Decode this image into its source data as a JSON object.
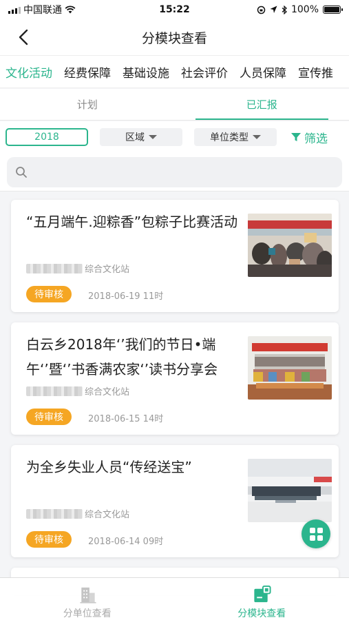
{
  "status_bar": {
    "carrier": "中国联通",
    "time": "15:22",
    "battery": "100%"
  },
  "nav": {
    "title": "分模块查看"
  },
  "module_tabs": [
    {
      "label": "文化活动",
      "active": true
    },
    {
      "label": "经费保障"
    },
    {
      "label": "基础设施"
    },
    {
      "label": "社会评价"
    },
    {
      "label": "人员保障"
    },
    {
      "label": "宣传推"
    }
  ],
  "sub_tabs": [
    {
      "label": "计划"
    },
    {
      "label": "已汇报",
      "active": true
    }
  ],
  "filters": {
    "year": "2018",
    "area": "区域",
    "unit_type": "单位类型",
    "filter": "筛选"
  },
  "search": {
    "placeholder": ""
  },
  "cards": [
    {
      "title": "“五月端午.迎粽香”包粽子比赛活动",
      "org": "综合文化站",
      "status": "待审核",
      "date": "2018-06-19 11时"
    },
    {
      "title": "白云乡2018年‘’我们的节日•端午‘’暨‘’书香满农家‘’读书分享会",
      "org": "综合文化站",
      "status": "待审核",
      "date": "2018-06-15 14时"
    },
    {
      "title": "为全乡失业人员“传经送宝”",
      "org": "综合文化站",
      "status": "待审核",
      "date": "2018-06-14 09时"
    }
  ],
  "bottom_nav": [
    {
      "label": "分单位查看",
      "icon": "building-icon"
    },
    {
      "label": "分模块查看",
      "icon": "module-icon",
      "active": true
    }
  ],
  "colors": {
    "accent": "#2bb58d",
    "badge": "#f5a623"
  }
}
